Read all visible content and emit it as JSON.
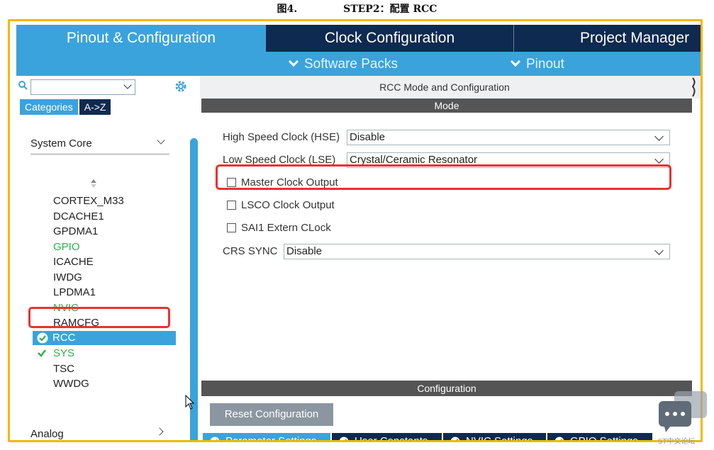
{
  "caption": {
    "figure": "图4.",
    "title": "STEP2：配置 RCC"
  },
  "top_tabs": [
    {
      "label": "Pinout & Configuration"
    },
    {
      "label": "Clock Configuration"
    },
    {
      "label": "Project Manager"
    }
  ],
  "sub_bar": {
    "software_packs": "Software Packs",
    "pinout": "Pinout"
  },
  "left": {
    "search_value": "",
    "tabs": {
      "categories": "Categories",
      "az": "A->Z"
    },
    "section": "System Core",
    "items": [
      {
        "label": "CORTEX_M33",
        "status": "normal"
      },
      {
        "label": "DCACHE1",
        "status": "normal"
      },
      {
        "label": "GPDMA1",
        "status": "normal"
      },
      {
        "label": "GPIO",
        "status": "configured"
      },
      {
        "label": "ICACHE",
        "status": "normal"
      },
      {
        "label": "IWDG",
        "status": "normal"
      },
      {
        "label": "LPDMA1",
        "status": "normal"
      },
      {
        "label": "NVIC",
        "status": "configured"
      },
      {
        "label": "RAMCFG",
        "status": "normal"
      }
    ],
    "selected": "RCC",
    "after_items": [
      {
        "label": "SYS",
        "status": "configured"
      },
      {
        "label": "TSC",
        "status": "normal"
      },
      {
        "label": "WWDG",
        "status": "normal"
      }
    ],
    "analog": "Analog"
  },
  "right": {
    "title": "RCC Mode and Configuration",
    "mode_label": "Mode",
    "hse": {
      "label": "High Speed Clock (HSE)",
      "value": "Disable"
    },
    "lse": {
      "label": "Low Speed Clock (LSE)",
      "value": "Crystal/Ceramic Resonator"
    },
    "checks": [
      {
        "label": "Master Clock Output",
        "checked": false
      },
      {
        "label": "LSCO Clock Output",
        "checked": false
      },
      {
        "label": "SAI1 Extern CLock",
        "checked": false
      }
    ],
    "crs": {
      "label": "CRS SYNC",
      "value": "Disable"
    },
    "config_label": "Configuration",
    "reset_label": "Reset Configuration",
    "settings_tabs": [
      {
        "label": "Parameter Settings",
        "active": true
      },
      {
        "label": "User Constants",
        "active": false
      },
      {
        "label": "NVIC Settings",
        "active": false
      },
      {
        "label": "GPIO Settings",
        "active": false
      }
    ]
  },
  "watermark": "ST中文论坛",
  "colors": {
    "accent": "#3aa3dc",
    "navy": "#0e2a50",
    "highlight": "#e8322f",
    "frame": "#f5b800",
    "configured": "#2fb04a"
  }
}
